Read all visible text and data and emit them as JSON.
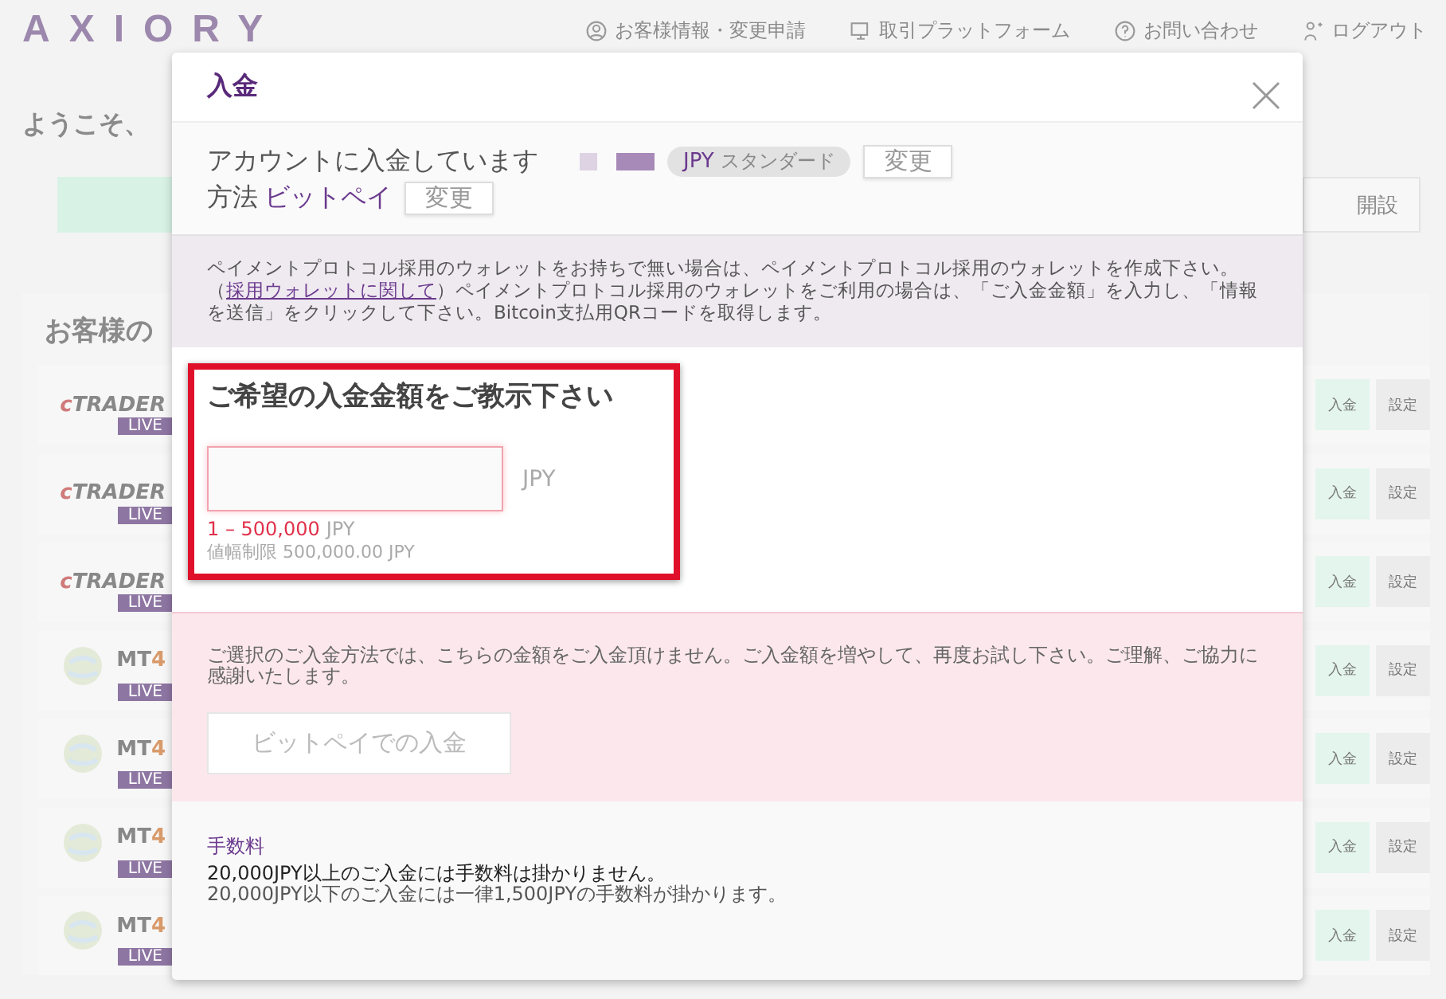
{
  "page": {
    "logo": "AXIORY",
    "nav": [
      {
        "label": "お客様情報・変更申請"
      },
      {
        "label": "取引プラットフォーム"
      },
      {
        "label": "お問い合わせ"
      },
      {
        "label": "ログアウト"
      }
    ],
    "welcome": "ようこそ、",
    "open_button": "開設",
    "section_title": "お客様の",
    "accounts": [
      {
        "kind": "ctrader",
        "logo_prefix": "c",
        "logo": "TRADER",
        "badge": "LIVE",
        "deposit": "入金",
        "settings": "設定"
      },
      {
        "kind": "ctrader",
        "logo_prefix": "c",
        "logo": "TRADER",
        "badge": "LIVE",
        "deposit": "入金",
        "settings": "設定"
      },
      {
        "kind": "ctrader",
        "logo_prefix": "c",
        "logo": "TRADER",
        "badge": "LIVE",
        "deposit": "入金",
        "settings": "設定"
      },
      {
        "kind": "mt4",
        "logo": "MT",
        "logo_suffix": "4",
        "badge": "LIVE",
        "deposit": "入金",
        "settings": "設定"
      },
      {
        "kind": "mt4",
        "logo": "MT",
        "logo_suffix": "4",
        "badge": "LIVE",
        "deposit": "入金",
        "settings": "設定"
      },
      {
        "kind": "mt4",
        "logo": "MT",
        "logo_suffix": "4",
        "badge": "LIVE",
        "deposit": "入金",
        "settings": "設定"
      },
      {
        "kind": "mt4",
        "logo": "MT",
        "logo_suffix": "4",
        "badge": "LIVE",
        "deposit": "入金",
        "settings": "設定"
      }
    ]
  },
  "modal": {
    "title": "入金",
    "account_label": "アカウントに入金しています",
    "account_currency": "JPY",
    "account_type": "スタンダード",
    "account_change": "変更",
    "method_label": "方法",
    "method": "ビットペイ",
    "method_change": "変更",
    "notice_before": "ペイメントプロトコル採用のウォレットをお持ちで無い場合は、ペイメントプロトコル採用のウォレットを作成下さい。（",
    "notice_link": "採用ウォレットに関して",
    "notice_after": "）ペイメントプロトコル採用のウォレットをご利用の場合は、「ご入金金額」を入力し、「情報を送信」をクリックして下さい。Bitcoin支払用QRコードを取得します。",
    "amount_title": "ご希望の入金金額をご教示下さい",
    "amount_highlighted": true,
    "amount_currency": "JPY",
    "range": "1 – 500,000",
    "range_unit": "JPY",
    "limit": "値幅制限 500,000.00 JPY",
    "error": "ご選択のご入金方法では、こちらの金額をご入金頂けません。ご入金額を増やして、再度お試し下さい。ご理解、ご協力に感謝いたします。",
    "submit": {
      "label": "ビットペイでの入金",
      "disabled": true
    },
    "fees_title": "手数料",
    "fees": [
      "20,000JPY以上のご入金には手数料は掛かりません。",
      "20,000JPY以下のご入金には一律1,500JPYの手数料が掛かります。"
    ]
  }
}
